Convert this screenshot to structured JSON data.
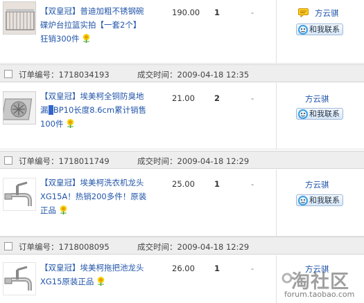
{
  "orders": [
    {
      "show_header": false,
      "order_label": "",
      "order_no": "",
      "time_label": "",
      "time": "",
      "item": {
        "title_lines": [
          "【双皇冠】普迪加粗不锈钢碗",
          "碟炉台拉篮实拍【一套2个】",
          "狂销300件"
        ],
        "price": "190.00",
        "qty": "1",
        "discount": "-",
        "seller": "方云骐",
        "contact": "和我联系",
        "thumb_icon": "dish-rack-thumb"
      }
    },
    {
      "show_header": true,
      "order_label": "订单编号：",
      "order_no": "1718034193",
      "time_label": "成交时间：",
      "time": "2009-04-18 12:35",
      "item": {
        "title_lines": [
          "【双皇冠】埃美柯全铜防臭地",
          "漏",
          "BP10长度8.6cm累计销售",
          "100件"
        ],
        "price": "21.00",
        "qty": "2",
        "discount": "-",
        "seller": "方云骐",
        "contact": "和我联系",
        "thumb_icon": "floor-drain-thumb"
      }
    },
    {
      "show_header": true,
      "order_label": "订单编号：",
      "order_no": "1718011749",
      "time_label": "成交时间：",
      "time": "2009-04-18 12:29",
      "item": {
        "title_lines": [
          "【双皇冠】埃美柯洗衣机龙头",
          "XG15A！热销200多件！原装",
          "正品"
        ],
        "price": "25.00",
        "qty": "1",
        "discount": "-",
        "seller": "方云骐",
        "contact": "和我联系",
        "thumb_icon": "faucet-thumb"
      }
    },
    {
      "show_header": true,
      "order_label": "订单编号：",
      "order_no": "1718008095",
      "time_label": "成交时间：",
      "time": "2009-04-18 12:29",
      "item": {
        "title_lines": [
          "【双皇冠】埃美柯拖把池龙头",
          "XG15原装正品"
        ],
        "price": "26.00",
        "qty": "1",
        "discount": "-",
        "seller": "方云骐",
        "contact": "",
        "thumb_icon": "faucet-thumb"
      }
    }
  ],
  "watermark": {
    "text": "淘社区",
    "url": "forum.taobao.com"
  },
  "colors": {
    "link": "#2255aa",
    "header_bg": "#eeeeee",
    "highlight": "#3366cc"
  }
}
